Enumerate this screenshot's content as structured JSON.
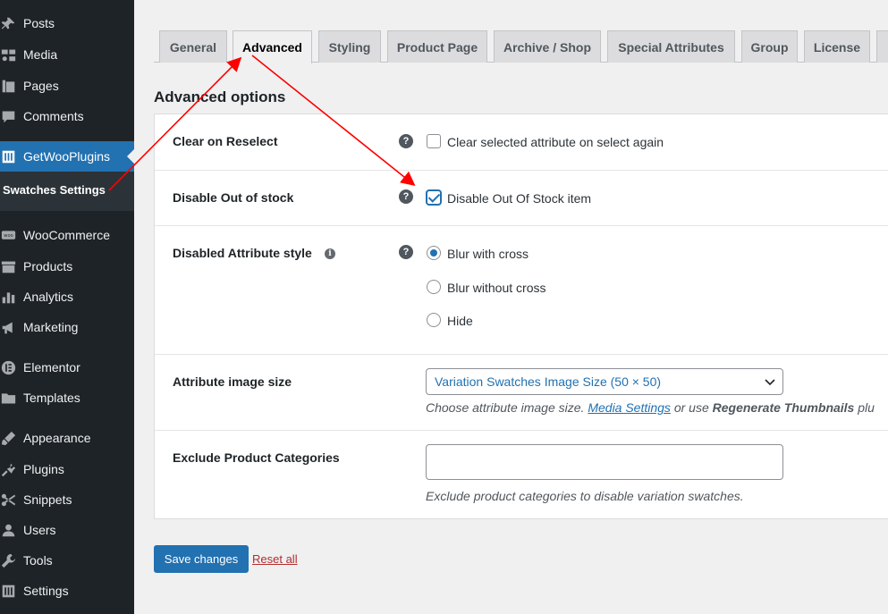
{
  "sidebar": {
    "items": [
      {
        "label": "Posts",
        "icon": "pin-icon"
      },
      {
        "label": "Media",
        "icon": "media-icon"
      },
      {
        "label": "Pages",
        "icon": "pages-icon"
      },
      {
        "label": "Comments",
        "icon": "comment-icon"
      },
      {
        "label": "GetWooPlugins",
        "icon": "sliders-icon",
        "active": true
      },
      {
        "label": "WooCommerce",
        "icon": "woo-icon"
      },
      {
        "label": "Products",
        "icon": "archive-icon"
      },
      {
        "label": "Analytics",
        "icon": "chart-icon"
      },
      {
        "label": "Marketing",
        "icon": "megaphone-icon"
      },
      {
        "label": "Elementor",
        "icon": "elementor-icon"
      },
      {
        "label": "Templates",
        "icon": "folder-icon"
      },
      {
        "label": "Appearance",
        "icon": "brush-icon"
      },
      {
        "label": "Plugins",
        "icon": "plug-icon"
      },
      {
        "label": "Snippets",
        "icon": "scissors-icon"
      },
      {
        "label": "Users",
        "icon": "user-icon"
      },
      {
        "label": "Tools",
        "icon": "wrench-icon"
      },
      {
        "label": "Settings",
        "icon": "settings-sliders-icon"
      }
    ],
    "submenu": {
      "label": "Swatches Settings"
    }
  },
  "tabs": [
    {
      "label": "General"
    },
    {
      "label": "Advanced",
      "active": true
    },
    {
      "label": "Styling"
    },
    {
      "label": "Product Page"
    },
    {
      "label": "Archive / Shop"
    },
    {
      "label": "Special Attributes"
    },
    {
      "label": "Group"
    },
    {
      "label": "License"
    }
  ],
  "section": {
    "title": "Advanced options"
  },
  "settings": {
    "clear_on_reselect": {
      "label": "Clear on Reselect",
      "option": "Clear selected attribute on select again",
      "checked": false
    },
    "disable_out_of_stock": {
      "label": "Disable Out of stock",
      "option": "Disable Out Of Stock item",
      "checked": true
    },
    "disabled_attribute_style": {
      "label": "Disabled Attribute style",
      "options": [
        "Blur with cross",
        "Blur without cross",
        "Hide"
      ],
      "selected": "Blur with cross"
    },
    "attribute_image_size": {
      "label": "Attribute image size",
      "value": "Variation Swatches Image Size (50 × 50)",
      "desc_prefix": "Choose attribute image size.",
      "desc_link": "Media Settings",
      "desc_mid": "or use",
      "desc_bold": "Regenerate Thumbnails",
      "desc_suffix": "plu"
    },
    "exclude_product_categories": {
      "label": "Exclude Product Categories",
      "value": "",
      "desc": "Exclude product categories to disable variation swatches."
    }
  },
  "footer": {
    "save_label": "Save changes",
    "reset_label": "Reset all"
  },
  "colors": {
    "accent": "#2271b1",
    "sidebar_bg": "#1d2327",
    "annotation": "#ff0000",
    "danger": "#b32d2e"
  }
}
